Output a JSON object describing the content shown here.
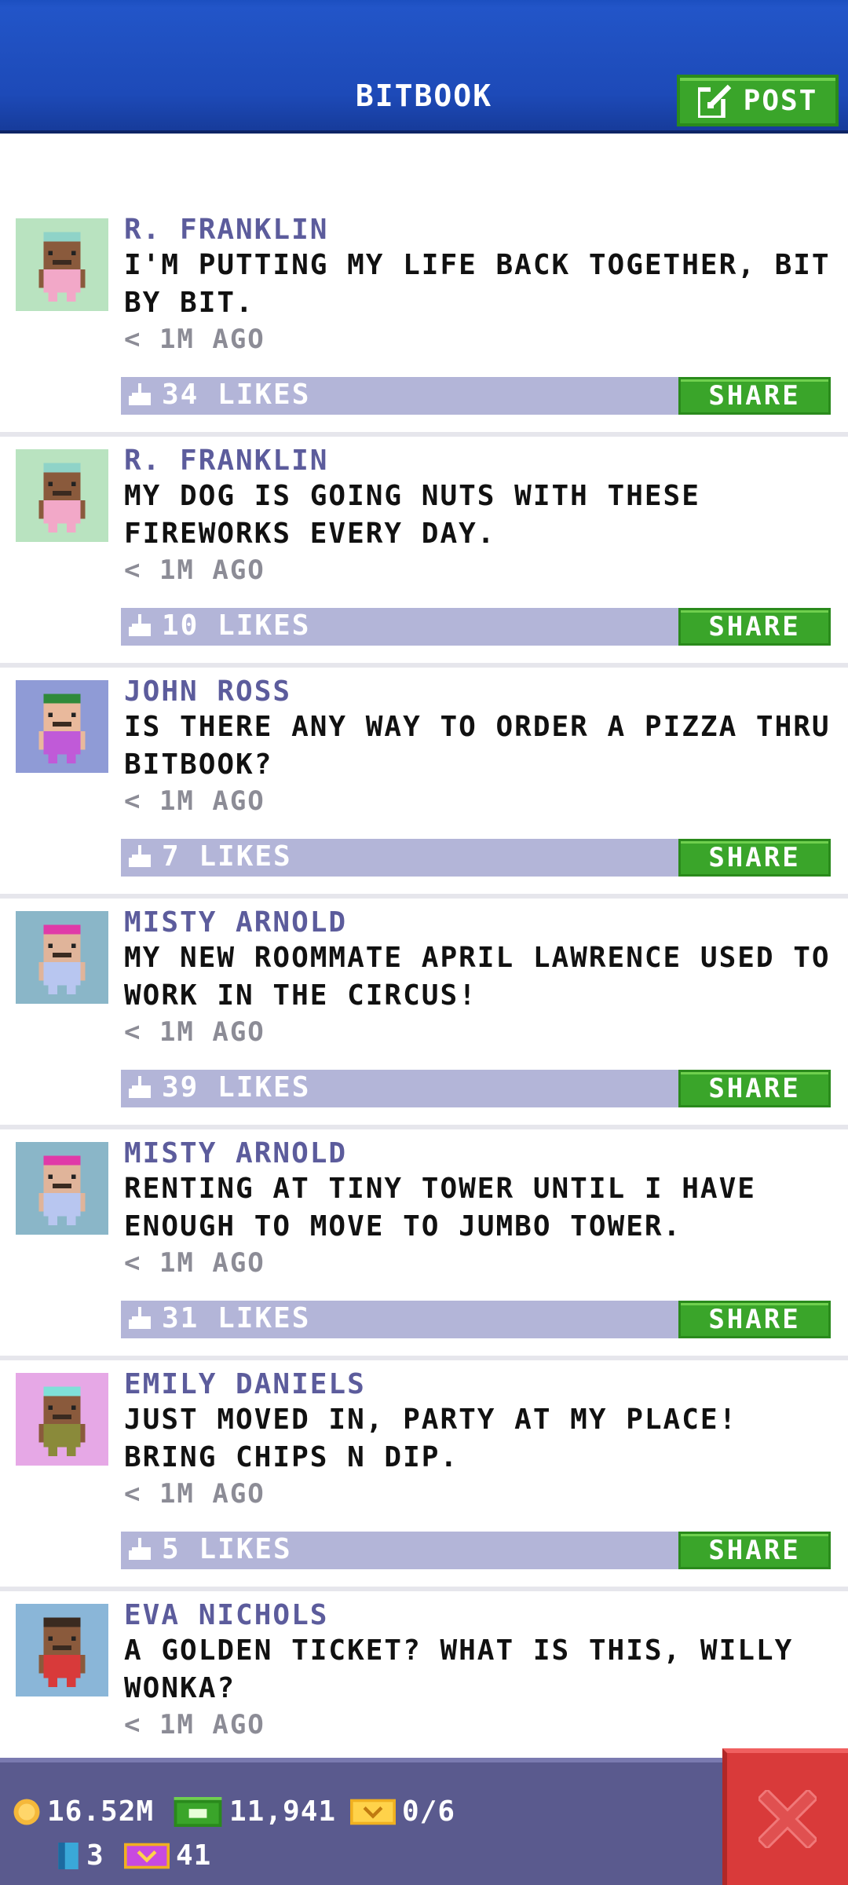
{
  "header": {
    "title": "BITBOOK",
    "post_label": "POST"
  },
  "posts": [
    {
      "author": "R. FRANKLIN",
      "message": "I'M PUTTING MY LIFE BACK TOGETHER, BIT BY BIT.",
      "time": "< 1M AGO",
      "likes": "34 LIKES",
      "share": "SHARE",
      "avatar": {
        "bg": "#b9e3c0",
        "skin": "#8a5a3c",
        "hair": "#8fd3c8",
        "shirt": "#f2a8c8"
      }
    },
    {
      "author": "R. FRANKLIN",
      "message": "MY DOG IS GOING NUTS WITH THESE FIREWORKS EVERY DAY.",
      "time": "< 1M AGO",
      "likes": "10 LIKES",
      "share": "SHARE",
      "avatar": {
        "bg": "#b9e3c0",
        "skin": "#8a5a3c",
        "hair": "#8fd3c8",
        "shirt": "#f2a8c8"
      }
    },
    {
      "author": "JOHN ROSS",
      "message": "IS THERE ANY WAY TO ORDER A PIZZA THRU BITBOOK?",
      "time": "< 1M AGO",
      "likes": "7 LIKES",
      "share": "SHARE",
      "avatar": {
        "bg": "#8f9bd6",
        "skin": "#e9b99c",
        "hair": "#2f8a3a",
        "shirt": "#c05ad8"
      }
    },
    {
      "author": "MISTY ARNOLD",
      "message": "MY NEW ROOMMATE APRIL LAWRENCE USED TO WORK IN THE CIRCUS!",
      "time": "< 1M AGO",
      "likes": "39 LIKES",
      "share": "SHARE",
      "avatar": {
        "bg": "#8ab6c8",
        "skin": "#e0b49a",
        "hair": "#e03aa8",
        "shirt": "#b8c6f0"
      }
    },
    {
      "author": "MISTY ARNOLD",
      "message": "RENTING AT TINY TOWER UNTIL I HAVE ENOUGH TO MOVE TO JUMBO TOWER.",
      "time": "< 1M AGO",
      "likes": "31 LIKES",
      "share": "SHARE",
      "avatar": {
        "bg": "#8ab6c8",
        "skin": "#e0b49a",
        "hair": "#e03aa8",
        "shirt": "#b8c6f0"
      }
    },
    {
      "author": "EMILY DANIELS",
      "message": "JUST MOVED IN, PARTY AT MY PLACE! BRING CHIPS N DIP.",
      "time": "< 1M AGO",
      "likes": "5 LIKES",
      "share": "SHARE",
      "avatar": {
        "bg": "#e6a8e6",
        "skin": "#8a5a3c",
        "hair": "#7fe0d8",
        "shirt": "#8a8a3a"
      }
    },
    {
      "author": "EVA NICHOLS",
      "message": "A GOLDEN TICKET? WHAT IS THIS, WILLY WONKA?",
      "time": "< 1M AGO",
      "likes": "",
      "share": "",
      "avatar": {
        "bg": "#8ab6d8",
        "skin": "#8a5a3c",
        "hair": "#3a2a20",
        "shirt": "#d83a3a"
      }
    }
  ],
  "footer": {
    "coins": "16.52M",
    "bux": "11,941",
    "tickets": "0/6",
    "floors": "3",
    "vip": "41"
  },
  "colors": {
    "header_blue": "#1d4ab8",
    "accent_green": "#3aa52a",
    "likes_bar": "#b3b5d8",
    "author_text": "#5c5c9c",
    "footer": "#5a5a8e",
    "close_red": "#d93a3a"
  }
}
